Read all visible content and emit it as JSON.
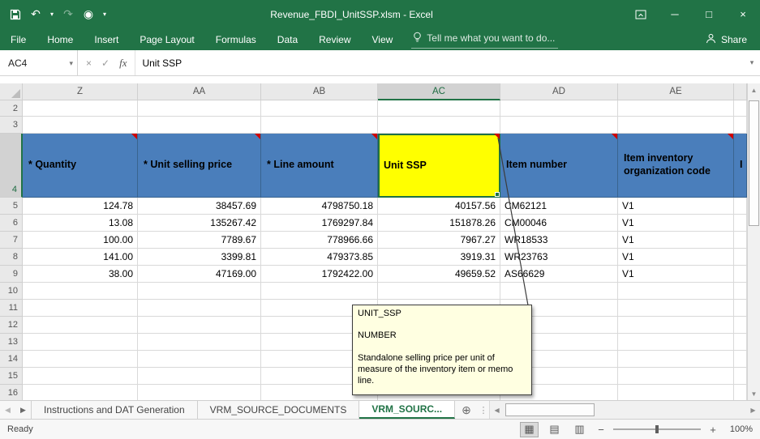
{
  "title_bar": {
    "title": "Revenue_FBDI_UnitSSP.xlsm - Excel"
  },
  "ribbon": {
    "tabs": [
      "File",
      "Home",
      "Insert",
      "Page Layout",
      "Formulas",
      "Data",
      "Review",
      "View"
    ],
    "tell_me": "Tell me what you want to do...",
    "share_label": "Share"
  },
  "formula_bar": {
    "name_box": "AC4",
    "content": "Unit SSP"
  },
  "grid": {
    "column_headers": [
      "Z",
      "AA",
      "AB",
      "AC",
      "AD",
      "AE"
    ],
    "active_column": "AC",
    "active_row": "4",
    "active_cell": "AC4",
    "row_numbers": [
      "2",
      "3",
      "4",
      "5",
      "6",
      "7",
      "8",
      "9",
      "10",
      "11",
      "12",
      "13",
      "14",
      "15",
      "16"
    ],
    "header_cells": [
      "* Quantity",
      "* Unit selling price",
      "* Line amount",
      "Unit SSP",
      "Item number",
      "Item inventory organization code"
    ],
    "partial_header": "I",
    "rows": [
      {
        "cells": [
          "124.78",
          "38457.69",
          "4798750.18",
          "40157.56",
          "CM62121",
          "V1"
        ]
      },
      {
        "cells": [
          "13.08",
          "135267.42",
          "1769297.84",
          "151878.26",
          "CM00046",
          "V1"
        ]
      },
      {
        "cells": [
          "100.00",
          "7789.67",
          "778966.66",
          "7967.27",
          "WR18533",
          "V1"
        ]
      },
      {
        "cells": [
          "141.00",
          "3399.81",
          "479373.85",
          "3919.31",
          "WR23763",
          "V1"
        ]
      },
      {
        "cells": [
          "38.00",
          "47169.00",
          "1792422.00",
          "49659.52",
          "AS66629",
          "V1"
        ]
      }
    ]
  },
  "comment_box": {
    "title": "UNIT_SSP",
    "type": "NUMBER",
    "description": "Standalone selling price per unit of measure of the inventory item or memo line."
  },
  "sheet_tabs": {
    "tabs": [
      "Instructions and DAT Generation",
      "VRM_SOURCE_DOCUMENTS",
      "VRM_SOURC..."
    ]
  },
  "status_bar": {
    "ready": "Ready",
    "zoom": "100%"
  },
  "icons": {
    "undo": "↶",
    "redo": "↷",
    "caret_down": "▾",
    "touch_mode": "◉",
    "minimize": "─",
    "maximize": "□",
    "close": "×",
    "cancel": "×",
    "confirm": "✓",
    "fx": "fx",
    "up_arrow": "▲",
    "down_arrow": "▼",
    "left_arrow": "◀",
    "right_arrow": "▶",
    "new_sheet": "⊕",
    "splitter_dots": "⋮",
    "view_normal": "▦",
    "view_layout": "▤",
    "view_break": "▥",
    "zoom_minus": "−",
    "zoom_plus": "+"
  },
  "colors": {
    "excel_green": "#217346",
    "header_blue": "#4A7EBB",
    "selection_yellow": "#FFFF00",
    "comment_yellow": "#FFFFE1",
    "flag_red": "#D00000"
  }
}
